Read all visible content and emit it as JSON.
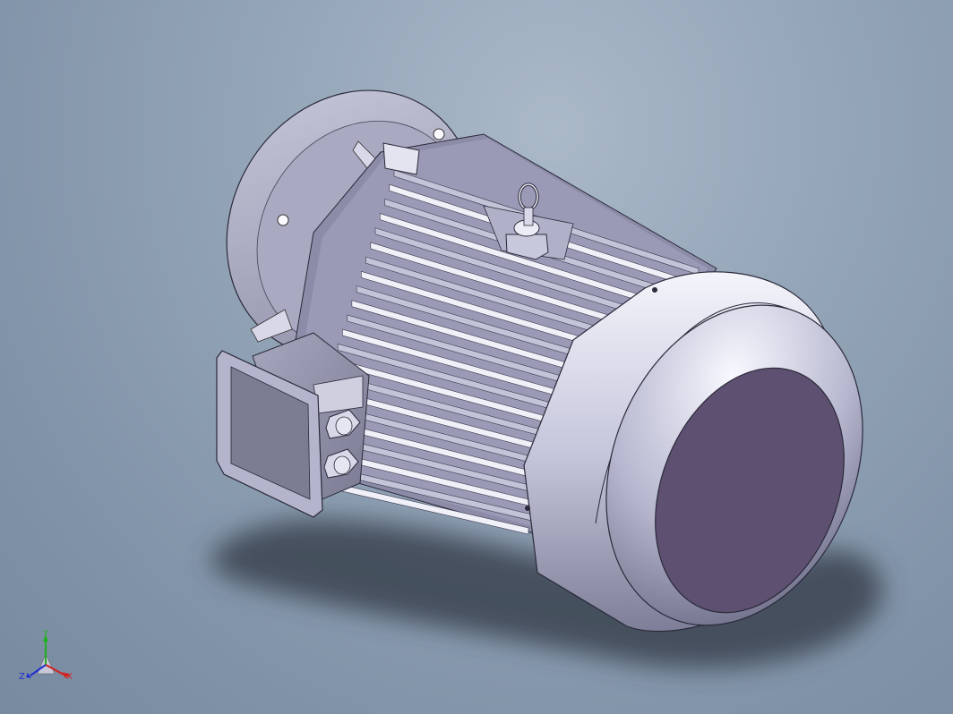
{
  "viewport": {
    "background_top": "#aab8c8",
    "background_bottom": "#788aa0",
    "model": "motor-3d-model"
  },
  "triad": {
    "x_label": "X",
    "y_label": "Y",
    "z_label": "Z",
    "x_color": "#d42020",
    "y_color": "#20b020",
    "z_color": "#2030d0"
  },
  "colors": {
    "body_light": "#e8e8f4",
    "body_mid": "#b8b8d0",
    "body_dark": "#70708a",
    "cap_face": "#5e5070",
    "outline": "#2a2a3a"
  }
}
